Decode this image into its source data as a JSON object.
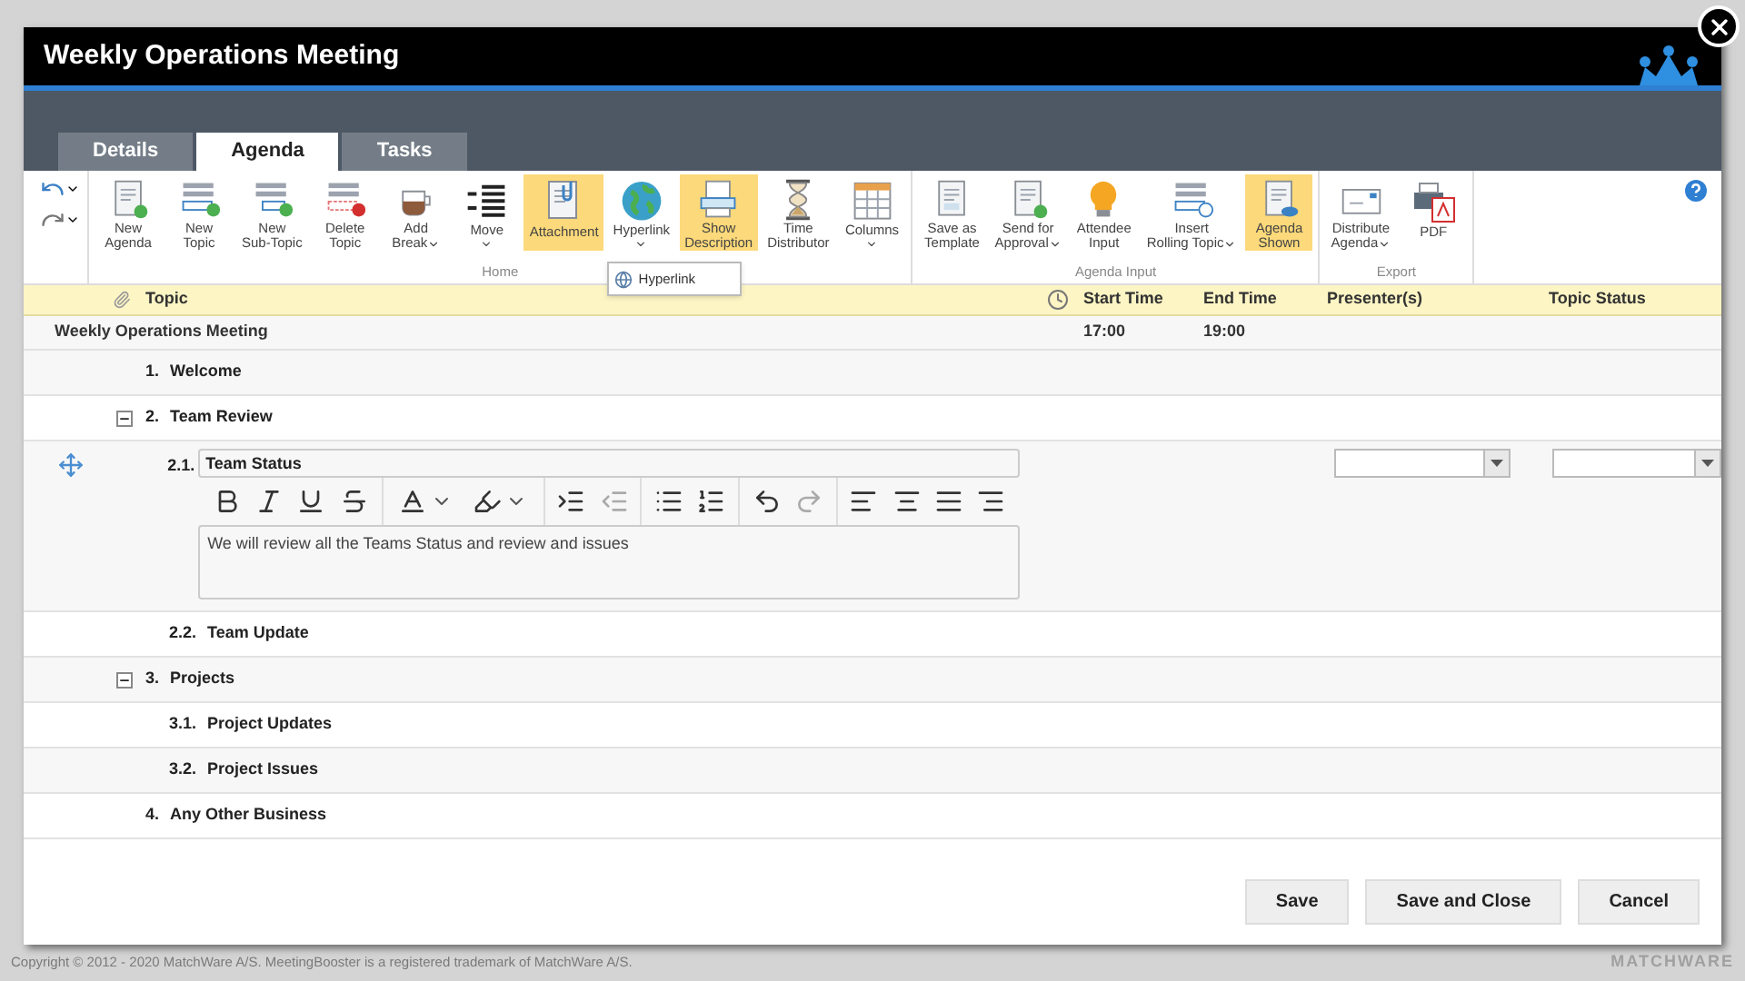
{
  "window": {
    "title": "Weekly Operations Meeting"
  },
  "tabs": [
    {
      "label": "Details",
      "selected": false
    },
    {
      "label": "Agenda",
      "selected": true
    },
    {
      "label": "Tasks",
      "selected": false
    }
  ],
  "ribbon": {
    "groups": [
      {
        "label": "Home",
        "buttons": [
          {
            "kind": "new-agenda",
            "lines": [
              "New",
              "Agenda"
            ],
            "has_menu": false,
            "selected": false
          },
          {
            "kind": "new-topic",
            "lines": [
              "New",
              "Topic"
            ],
            "has_menu": false,
            "selected": false
          },
          {
            "kind": "new-subtopic",
            "lines": [
              "New",
              "Sub-Topic"
            ],
            "has_menu": false,
            "selected": false
          },
          {
            "kind": "delete-topic",
            "lines": [
              "Delete",
              "Topic"
            ],
            "has_menu": false,
            "selected": false
          },
          {
            "kind": "break",
            "lines": [
              "Add",
              "Break"
            ],
            "has_menu": true,
            "selected": false
          },
          {
            "kind": "move",
            "lines": [
              "Move"
            ],
            "has_menu": true,
            "selected": false
          },
          {
            "kind": "attachment",
            "lines": [
              "Attachment"
            ],
            "has_menu": false,
            "selected": true
          },
          {
            "kind": "hyperlink",
            "lines": [
              "Hyperlink"
            ],
            "has_menu": true,
            "selected": false,
            "menu": [
              {
                "label": "Hyperlink"
              }
            ]
          },
          {
            "kind": "description",
            "lines": [
              "Show",
              "Description"
            ],
            "has_menu": false,
            "selected": true
          },
          {
            "kind": "time",
            "lines": [
              "Time",
              "Distributor"
            ],
            "has_menu": false,
            "selected": false
          },
          {
            "kind": "columns",
            "lines": [
              "Columns"
            ],
            "has_menu": true,
            "selected": false
          }
        ]
      },
      {
        "label": "Agenda Input",
        "buttons": [
          {
            "kind": "template",
            "lines": [
              "Save as",
              "Template"
            ],
            "has_menu": false,
            "selected": false
          },
          {
            "kind": "approval",
            "lines": [
              "Send for",
              "Approval"
            ],
            "has_menu": true,
            "selected": false
          },
          {
            "kind": "bulb",
            "lines": [
              "Attendee",
              "Input"
            ],
            "has_menu": false,
            "selected": false
          },
          {
            "kind": "rolling",
            "lines": [
              "Insert",
              "Rolling Topic"
            ],
            "has_menu": true,
            "selected": false
          },
          {
            "kind": "shown",
            "lines": [
              "Agenda",
              "Shown"
            ],
            "has_menu": false,
            "selected": true
          }
        ]
      },
      {
        "label": "Export",
        "buttons": [
          {
            "kind": "distribute",
            "lines": [
              "Distribute",
              "Agenda"
            ],
            "has_menu": true,
            "selected": false
          },
          {
            "kind": "pdf",
            "lines": [
              "PDF"
            ],
            "has_menu": false,
            "selected": false
          }
        ]
      }
    ]
  },
  "table": {
    "columns": [
      "Topic",
      "Start Time",
      "End Time",
      "Presenter(s)",
      "Topic Status"
    ],
    "meeting": {
      "title": "Weekly Operations Meeting",
      "start": "17:00",
      "end": "19:00"
    },
    "topics": [
      {
        "number": "1.",
        "title": "Welcome"
      },
      {
        "number": "2.",
        "title": "Team Review",
        "expanded": true,
        "children": [
          {
            "number": "2.1.",
            "title": "Team Status",
            "kind": "editing",
            "description": "We will review all the Teams Status and review and issues"
          },
          {
            "number": "2.2.",
            "title": "Team Update"
          }
        ]
      },
      {
        "number": "3.",
        "title": "Projects",
        "expanded": true,
        "children": [
          {
            "number": "3.1.",
            "title": "Project Updates"
          },
          {
            "number": "3.2.",
            "title": "Project Issues"
          }
        ]
      },
      {
        "number": "4.",
        "title": "Any Other Business"
      }
    ]
  },
  "editor_toolbar": [
    {
      "kind": "bold",
      "disabled": false
    },
    {
      "kind": "italic",
      "disabled": false
    },
    {
      "kind": "underline",
      "disabled": false
    },
    {
      "kind": "strike",
      "disabled": false
    },
    {
      "kind": "sep"
    },
    {
      "kind": "color",
      "disabled": false
    },
    {
      "kind": "highlight",
      "disabled": false
    },
    {
      "kind": "sep"
    },
    {
      "kind": "indent",
      "disabled": false
    },
    {
      "kind": "outdent",
      "disabled": true
    },
    {
      "kind": "sep"
    },
    {
      "kind": "bullets",
      "disabled": false
    },
    {
      "kind": "numbers",
      "disabled": false
    },
    {
      "kind": "sep"
    },
    {
      "kind": "undo",
      "disabled": false
    },
    {
      "kind": "redo",
      "disabled": true
    },
    {
      "kind": "sep"
    },
    {
      "kind": "left",
      "disabled": false
    },
    {
      "kind": "center",
      "disabled": false
    },
    {
      "kind": "justify",
      "disabled": false
    },
    {
      "kind": "right",
      "disabled": false
    }
  ],
  "buttons": [
    "Save",
    "Save and Close",
    "Cancel"
  ],
  "footer": {
    "copyright": "Copyright © 2012 - 2020 MatchWare A/S. MeetingBooster is a registered trademark of MatchWare A/S.",
    "logo": "MATCHWARE"
  }
}
